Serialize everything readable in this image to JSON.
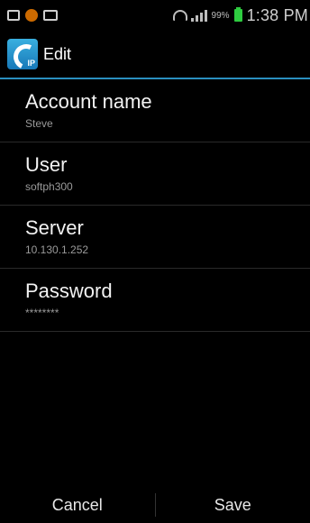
{
  "status_bar": {
    "battery_percent": "99%",
    "time": "1:38 PM"
  },
  "action_bar": {
    "title": "Edit"
  },
  "settings": [
    {
      "title": "Account name",
      "summary": "Steve"
    },
    {
      "title": "User",
      "summary": "softph300"
    },
    {
      "title": "Server",
      "summary": "10.130.1.252"
    },
    {
      "title": "Password",
      "summary": "********"
    }
  ],
  "buttons": {
    "cancel": "Cancel",
    "save": "Save"
  },
  "colors": {
    "accent": "#2a8fbf",
    "battery": "#2ecc40"
  }
}
